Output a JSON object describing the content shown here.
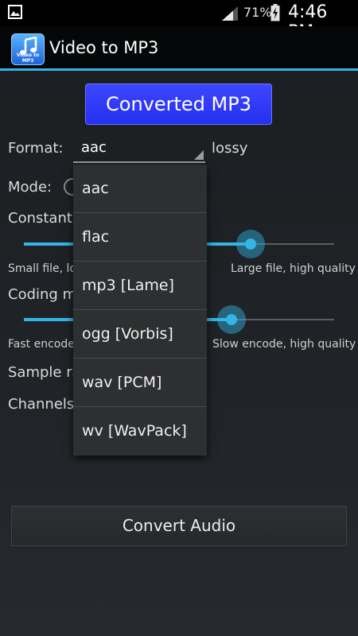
{
  "status_bar": {
    "battery_percent": "71%",
    "time": "4:46 PM",
    "icons": [
      "gallery-icon",
      "signal-icon",
      "battery-charging-icon"
    ]
  },
  "action_bar": {
    "title": "Video to MP3",
    "app_icon_label": "Video to MP3",
    "app_icon": "music-note-icon"
  },
  "main": {
    "converted_button": "Converted MP3",
    "format_label": "Format:",
    "format_value": "aac",
    "format_note": "lossy",
    "mode_label": "Mode:",
    "constant_label": "Constant",
    "quality_min": "Small file, lo",
    "quality_max": "Large file, high quality",
    "coding_label": "Coding m",
    "speed_min": "Fast encode",
    "speed_max": "Slow encode, high quality",
    "sample_label": "Sample ra",
    "channels_label": "Channels",
    "convert_button": "Convert Audio"
  },
  "sliders": {
    "quality_value": 0.73,
    "speed_value": 0.67
  },
  "dropdown": {
    "options": [
      "aac",
      "flac",
      "mp3 [Lame]",
      "ogg [Vorbis]",
      "wav [PCM]",
      "wv [WavPack]"
    ]
  },
  "colors": {
    "accent": "#33b5e5",
    "converted_button": "#2f38f8"
  }
}
